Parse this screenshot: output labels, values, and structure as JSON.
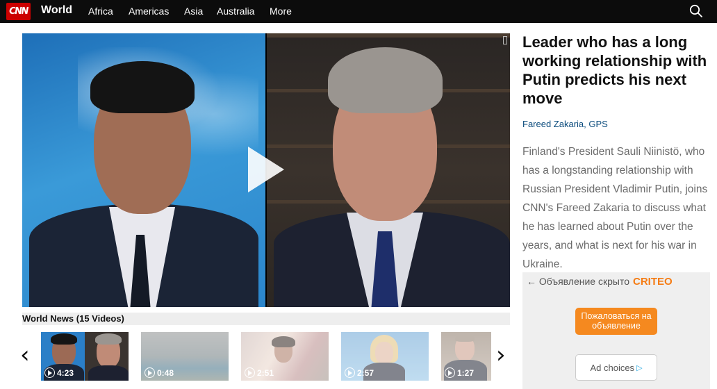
{
  "nav": {
    "logo": "CNN",
    "section": "World",
    "links": [
      "Africa",
      "Americas",
      "Asia",
      "Australia",
      "More"
    ],
    "search_icon": "search-icon"
  },
  "video": {
    "play_icon": "play-icon"
  },
  "playlist": {
    "title": "World News (15 Videos)",
    "prev_icon": "chevron-left-icon",
    "next_icon": "chevron-right-icon",
    "items": [
      {
        "duration": "4:23"
      },
      {
        "duration": "0:48"
      },
      {
        "duration": "2:51"
      },
      {
        "duration": "2:57"
      },
      {
        "duration": "1:27"
      }
    ]
  },
  "article": {
    "headline": "Leader who has a long working relationship with Putin predicts his next move",
    "byline": "Fareed Zakaria, GPS",
    "description": "Finland's President Sauli Niinistö, who has a longstanding relationship with Russian President Vladimir Putin, joins CNN's Fareed Zakaria to discuss what he has learned about Putin over the years, and what is next for his war in Ukraine."
  },
  "ad": {
    "hidden_label": "← Объявление скрыто",
    "brand": "CRITEO",
    "report_button": "Пожаловаться на объявление",
    "adchoices_button": "Ad choices",
    "accent_color": "#f5891f"
  }
}
